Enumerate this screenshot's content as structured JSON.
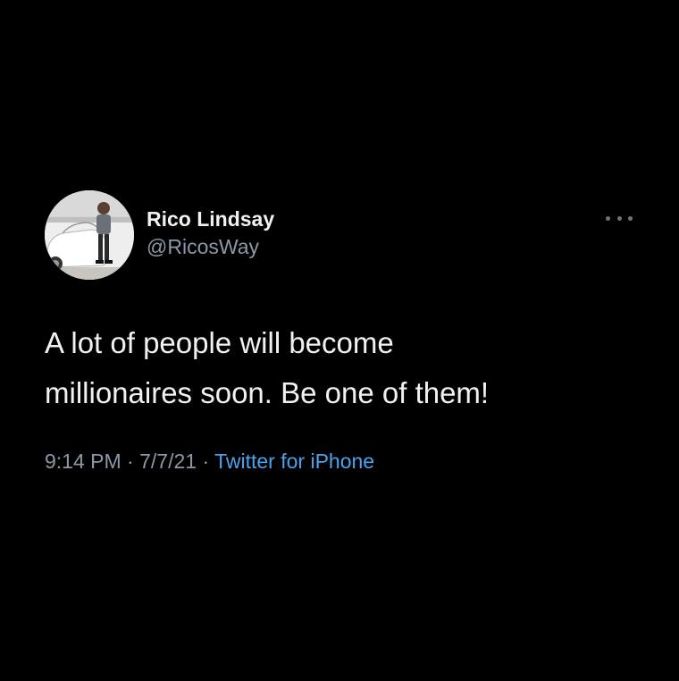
{
  "tweet": {
    "author": {
      "display_name": "Rico Lindsay",
      "handle": "@RicosWay"
    },
    "text_lines": [
      "A lot of people will become",
      "millionaires soon. Be one of them!"
    ],
    "time": "9:14 PM",
    "separator": "·",
    "date": "7/7/21",
    "source": "Twitter for iPhone"
  },
  "colors": {
    "background": "#000000",
    "text": "#f1f1f1",
    "secondary": "#8b98a5",
    "link": "#4aa3ec"
  },
  "icons": {
    "more": "more-horizontal-icon"
  }
}
